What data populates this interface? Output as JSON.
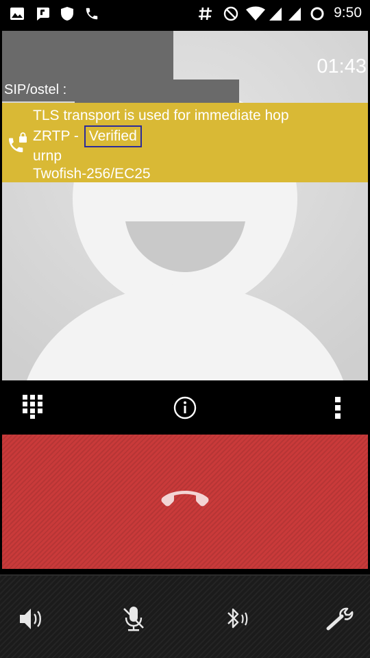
{
  "status_bar": {
    "icons": [
      "image-icon",
      "chat-icon",
      "shield-icon",
      "phone-icon",
      "hash-icon",
      "do-not-disturb-icon",
      "wifi-icon",
      "signal-icon",
      "signal-icon",
      "ring-icon"
    ],
    "time": "9:50"
  },
  "call": {
    "timer": "01:43",
    "remote_label": "SIP/ostel :",
    "security": {
      "line1": "TLS transport is used for immediate hop",
      "line2_prefix": "ZRTP - ",
      "verified": "Verified",
      "line3": "urnp",
      "line4": "Twofish-256/EC25",
      "banner_color": "#d9b935"
    }
  },
  "actions": {
    "dialpad": "dialpad-icon",
    "info": "info-icon",
    "more": "more-vert-icon"
  },
  "hangup": {
    "icon": "call-end-icon",
    "color": "#c93a3a"
  },
  "bottom_bar": {
    "items": [
      "speaker-icon",
      "mic-off-icon",
      "bluetooth-icon",
      "settings-wrench-icon"
    ]
  }
}
